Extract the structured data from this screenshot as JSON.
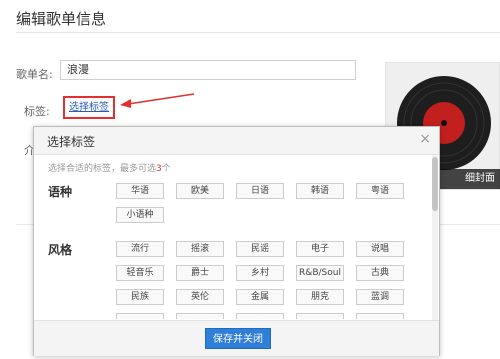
{
  "page": {
    "title": "编辑歌单信息"
  },
  "form": {
    "name_label": "歌单名:",
    "name_value": "浪漫",
    "tag_label": "标签:",
    "select_tag_link": "选择标签",
    "intro_label": "介"
  },
  "cover": {
    "caption": "细封面"
  },
  "dialog": {
    "title": "选择标签",
    "close": "×",
    "hint_prefix": "选择合适的标签，最多可选",
    "hint_count": "3",
    "hint_suffix": "个",
    "categories": [
      {
        "name": "语种",
        "tags": [
          "华语",
          "欧美",
          "日语",
          "韩语",
          "粤语",
          "小语种"
        ]
      },
      {
        "name": "风格",
        "tags": [
          "流行",
          "摇滚",
          "民谣",
          "电子",
          "说唱",
          "轻音乐",
          "爵士",
          "乡村",
          "R&B/Soul",
          "古典",
          "民族",
          "英伦",
          "金属",
          "朋克",
          "蓝调"
        ]
      }
    ],
    "save_button": "保存并关闭"
  },
  "colors": {
    "accent_blue": "#2f7ed8",
    "highlight_red": "#e03030"
  }
}
